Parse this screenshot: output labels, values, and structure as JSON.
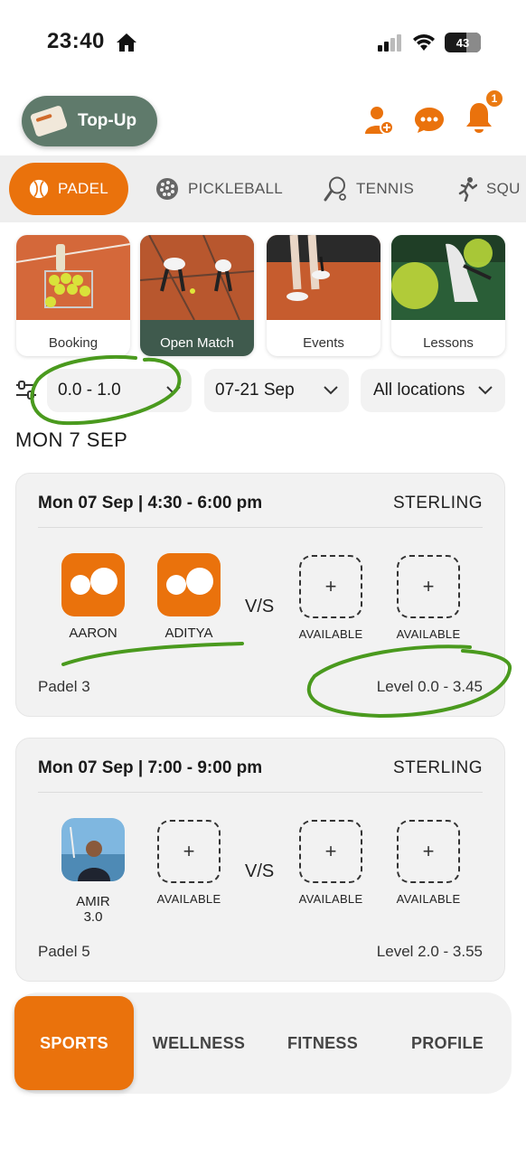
{
  "status_bar": {
    "time": "23:40",
    "battery": "43"
  },
  "header": {
    "topup_label": "Top-Up",
    "notification_count": "1"
  },
  "sports_tabs": [
    {
      "label": "PADEL",
      "active": true
    },
    {
      "label": "PICKLEBALL",
      "active": false
    },
    {
      "label": "TENNIS",
      "active": false
    },
    {
      "label": "SQU",
      "active": false
    }
  ],
  "services": [
    {
      "label": "Booking",
      "active": false
    },
    {
      "label": "Open Match",
      "active": true
    },
    {
      "label": "Events",
      "active": false
    },
    {
      "label": "Lessons",
      "active": false
    }
  ],
  "filters": {
    "level": "0.0 - 1.0",
    "dates": "07-21 Sep",
    "location": "All locations"
  },
  "date_heading": "MON 7 SEP",
  "matches": [
    {
      "datetime": "Mon 07 Sep | 4:30 - 6:00 pm",
      "club": "STERLING",
      "players": [
        {
          "name": "AARON"
        },
        {
          "name": "ADITYA"
        },
        {
          "name": "AVAILABLE"
        },
        {
          "name": "AVAILABLE"
        }
      ],
      "vs": "V/S",
      "court": "Padel 3",
      "level": "Level 0.0 - 3.45"
    },
    {
      "datetime": "Mon 07 Sep | 7:00 - 9:00 pm",
      "club": "STERLING",
      "players": [
        {
          "name": "AMIR",
          "rating": "3.0"
        },
        {
          "name": "AVAILABLE"
        },
        {
          "name": "AVAILABLE"
        },
        {
          "name": "AVAILABLE"
        }
      ],
      "vs": "V/S",
      "court": "Padel 5",
      "level": "Level 2.0 - 3.55"
    }
  ],
  "add_symbol": "+",
  "bottom_nav": [
    {
      "label": "SPORTS",
      "active": true
    },
    {
      "label": "WELLNESS",
      "active": false
    },
    {
      "label": "FITNESS",
      "active": false
    },
    {
      "label": "PROFILE",
      "active": false
    }
  ],
  "colors": {
    "accent": "#ea720c",
    "topup_bg": "#5f7a6b",
    "active_card": "#3f5a4d",
    "annotation": "#4a9a1e"
  }
}
